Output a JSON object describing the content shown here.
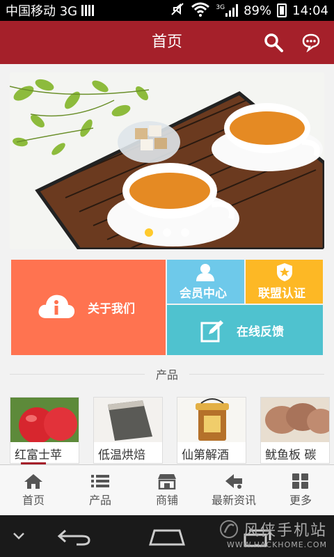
{
  "status_bar": {
    "carrier": "中国移动 3G",
    "network_badge": "3G",
    "battery": "89%",
    "time": "14:04"
  },
  "header": {
    "title": "首页",
    "icons": [
      "search-icon",
      "chat-bubble-icon"
    ]
  },
  "banner": {
    "dots": 3,
    "active_dot": 1
  },
  "tiles": {
    "about": "关于我们",
    "member": "会员中心",
    "league": "联盟认证",
    "feedback": "在线反馈",
    "colors": {
      "about": "#ff7350",
      "member": "#6ec9ea",
      "league": "#fdb825",
      "feedback": "#4fc2cf"
    }
  },
  "products": {
    "section_title": "产品",
    "items": [
      {
        "name": "红富士苹"
      },
      {
        "name": "低温烘焙"
      },
      {
        "name": "仙第解酒"
      },
      {
        "name": "鱿鱼板 碳"
      }
    ]
  },
  "bottom_nav": {
    "items": [
      {
        "label": "首页",
        "icon": "home-icon"
      },
      {
        "label": "产品",
        "icon": "list-icon"
      },
      {
        "label": "商铺",
        "icon": "shop-icon"
      },
      {
        "label": "最新资讯",
        "icon": "news-icon"
      },
      {
        "label": "更多",
        "icon": "grid-icon"
      }
    ]
  },
  "watermark": {
    "line1": "风侠手机站",
    "line2": "WWW.HACKHOME.COM"
  },
  "theme": {
    "brand": "#a5202a"
  }
}
